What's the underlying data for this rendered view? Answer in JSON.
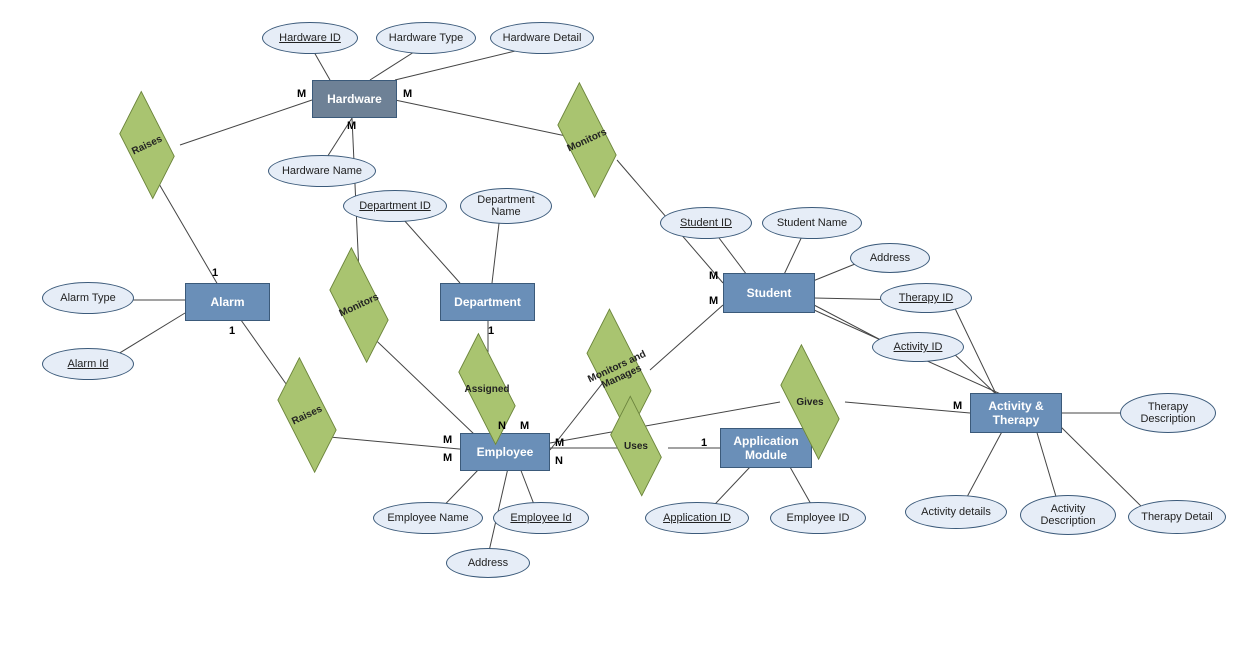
{
  "entities": {
    "hardware": "Hardware",
    "alarm": "Alarm",
    "department": "Department",
    "student": "Student",
    "employee": "Employee",
    "application_module": "Application Module",
    "activity_therapy": "Activity & Therapy"
  },
  "relations": {
    "raises_hw": "Raises",
    "raises_emp": "Raises",
    "monitors_emp_hw": "Monitors",
    "monitors_hw_stu": "Monitors",
    "assigned": "Assigned",
    "monitors_manages": "Monitors and\nManages",
    "uses": "Uses",
    "gives": "Gives"
  },
  "attrs": {
    "hardware_id": "Hardware ID",
    "hardware_type": "Hardware Type",
    "hardware_detail": "Hardware Detail",
    "hardware_name": "Hardware Name",
    "alarm_type": "Alarm Type",
    "alarm_id": "Alarm Id",
    "department_id": "Department ID",
    "department_name": "Department Name",
    "student_id": "Student ID",
    "student_name": "Student Name",
    "address_stu": "Address",
    "therapy_id_stu": "Therapy ID",
    "activity_id_stu": "Activity ID",
    "employee_name": "Employee Name",
    "employee_id": "Employee Id",
    "address_emp": "Address",
    "application_id": "Application ID",
    "employee_id_app": "Employee ID",
    "activity_details": "Activity details",
    "activity_desc": "Activity Description",
    "therapy_detail": "Therapy Detail",
    "therapy_desc": "Therapy Description"
  },
  "cards": {
    "c1": "M",
    "c2": "M",
    "c3": "M",
    "c4": "1",
    "c5": "1",
    "c6": "M",
    "c7": "M",
    "c8": "M",
    "c9": "M",
    "c10": "M",
    "c11": "1",
    "c12": "N",
    "c13": "M",
    "c14": "N",
    "c15": "1",
    "c16": "M"
  }
}
